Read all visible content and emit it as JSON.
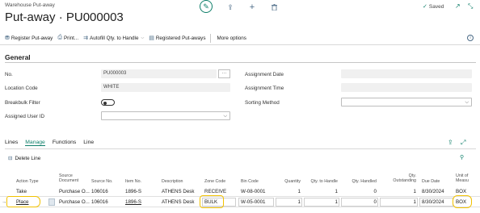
{
  "header": {
    "breadcrumb": "Warehouse Put-away",
    "title": "Put-away · PU000003",
    "saved_label": "Saved"
  },
  "actions": {
    "register": "Register Put-away",
    "print": "Print...",
    "autofill": "Autofill Qty. to Handle",
    "registered": "Registered Put-aways",
    "more": "More options"
  },
  "general": {
    "title": "General",
    "no_label": "No.",
    "no_value": "PU000003",
    "location_label": "Location Code",
    "location_value": "WHITE",
    "breakbulk_label": "Breakbulk Filter",
    "assigned_user_label": "Assigned User ID",
    "assignment_date_label": "Assignment Date",
    "assignment_time_label": "Assignment Time",
    "sorting_method_label": "Sorting Method"
  },
  "lines": {
    "tabs": {
      "lines": "Lines",
      "manage": "Manage",
      "functions": "Functions",
      "line": "Line"
    },
    "delete_line": "Delete Line",
    "columns": {
      "action_type": "Action Type",
      "source_document_1": "Source",
      "source_document_2": "Document",
      "source_no": "Source No.",
      "item_no": "Item No.",
      "description": "Description",
      "zone_code": "Zone Code",
      "bin_code": "Bin Code",
      "quantity": "Quantity",
      "qty_to_handle": "Qty. to Handle",
      "qty_handled": "Qty. Handled",
      "qty_outstanding_1": "Qty.",
      "qty_outstanding_2": "Outstanding",
      "due_date": "Due Date",
      "unit_1": "Unit of",
      "unit_2": "Measu"
    },
    "rows": [
      {
        "action_type": "Take",
        "source_document": "Purchase O...",
        "source_no": "106016",
        "item_no": "1896-S",
        "description": "ATHENS Desk",
        "zone_code": "RECEIVE",
        "bin_code": "W-08-0001",
        "quantity": "1",
        "qty_to_handle": "1",
        "qty_handled": "0",
        "qty_outstanding": "1",
        "due_date": "8/30/2024",
        "unit": "BOX"
      },
      {
        "action_type": "Place",
        "source_document": "Purchase O...",
        "source_no": "106016",
        "item_no": "1896-S",
        "description": "ATHENS Desk",
        "zone_code": "BULK",
        "bin_code": "W-05-0001",
        "quantity": "1",
        "qty_to_handle": "1",
        "qty_handled": "0",
        "qty_outstanding": "1",
        "due_date": "8/30/2024",
        "unit": "BOX"
      }
    ]
  },
  "colors": {
    "accent": "#0f7f6a",
    "icon": "#4a6a86",
    "annotation": "#f2c200"
  }
}
